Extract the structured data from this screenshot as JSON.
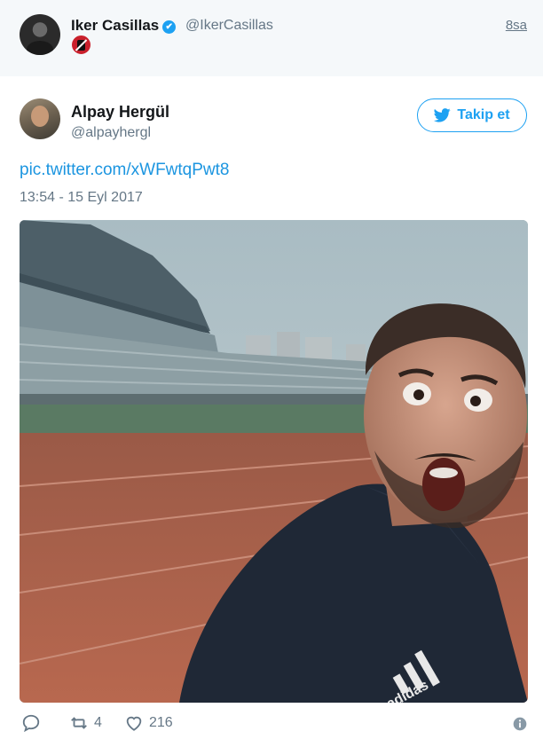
{
  "outer_tweet": {
    "name": "Iker Casillas",
    "handle": "@IkerCasillas",
    "time": "8sa",
    "emoji": "no-mobile-phones-icon"
  },
  "embedded_tweet": {
    "name": "Alpay Hergül",
    "handle": "@alpayhergl",
    "follow_label": "Takip et",
    "link_text": "pic.twitter.com/xWFwtqPwt8",
    "timestamp": "13:54 - 15 Eyl 2017",
    "media": {
      "shirt_brand": "adidas"
    },
    "actions": {
      "retweet_count": "4",
      "like_count": "216"
    }
  },
  "colors": {
    "accent": "#1da1f2",
    "link": "#1b95e0",
    "muted": "#657786",
    "outer_bg": "#f5f8fa"
  }
}
